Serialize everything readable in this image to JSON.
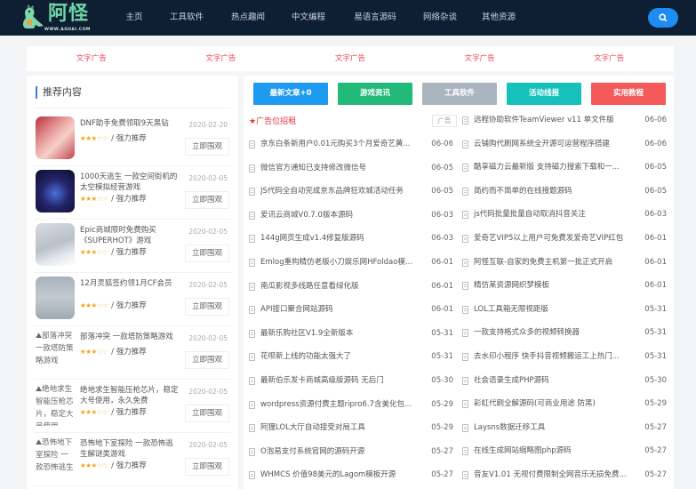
{
  "header": {
    "logo_text": "阿怪",
    "logo_url": "WWW.AGUAI.COM",
    "nav": [
      "主页",
      "工具软件",
      "热点趣闻",
      "中文编程",
      "易语言源码",
      "网络杂谈",
      "其他资源"
    ],
    "search_icon": "search-icon"
  },
  "adbar": {
    "items": [
      "文字广告",
      "文字广告",
      "文字广告",
      "文字广告",
      "文字广告"
    ],
    "color": "#e8495a"
  },
  "sidebar": {
    "title": "推荐内容",
    "meta_label": "/ 强力推荐",
    "button_label": "立即围观",
    "items": [
      {
        "title": "DNF助手免费领取9天黑钻",
        "date": "2020-02-20",
        "rating": 3,
        "thumb": "image"
      },
      {
        "title": "1000天逃生 一款空间街机的太空模拟经营游戏",
        "date": "2020-02-05",
        "rating": 3,
        "thumb": "image"
      },
      {
        "title": "Epic商城限时免费购买《SUPERHOT》游戏",
        "date": "2020-02-05",
        "rating": 3,
        "thumb": "image"
      },
      {
        "title": "12月灵狐签约领1月CF会员",
        "date": "2020-02-05",
        "rating": 3,
        "thumb": "image"
      },
      {
        "title": "部落冲突 一款塔防策略游戏",
        "date": "2020-02-05",
        "rating": 3,
        "thumb": "broken",
        "alt": "部落冲突 一款塔防策略游戏"
      },
      {
        "title": "绝地求生智能压枪芯片，稳定大号使用，永久免费",
        "date": "2020-02-05",
        "rating": 3,
        "thumb": "broken",
        "alt": "绝地求生智能压枪芯片，稳定大号使用"
      },
      {
        "title": "恐怖地下室探险 一款恐怖逃生解谜类游戏",
        "date": "2020-02-05",
        "rating": 3,
        "thumb": "broken",
        "alt": "恐怖地下室探险 一款恐怖逃生"
      }
    ]
  },
  "main": {
    "categories": [
      {
        "label": "最新文章+0",
        "color": "#1e9bf0"
      },
      {
        "label": "游戏资讯",
        "color": "#22b979"
      },
      {
        "label": "工具软件",
        "color": "#aab5bf"
      },
      {
        "label": "活动线报",
        "color": "#17c1bb"
      },
      {
        "label": "实用教程",
        "color": "#f45a5a"
      }
    ],
    "ad_recruit": "★广告位招租",
    "ad_tag": "广告",
    "left_articles": [
      {
        "title": "京东白条新用户0.01元购买3个月爱奇艺黄...",
        "date": "06-06"
      },
      {
        "title": "微信官方通知已支持修改微信号",
        "date": "06-05"
      },
      {
        "title": "JS代码全自动完成京东品牌狂欢城活动任务",
        "date": "06-05"
      },
      {
        "title": "爱讯云商城V0.7.0版本源码",
        "date": "06-03"
      },
      {
        "title": "144g网页生成v1.4修复版源码",
        "date": "06-03"
      },
      {
        "title": "Emlog重构精仿老版小刀娱乐网HFoldao模...",
        "date": "06-01"
      },
      {
        "title": "南瓜影视多线路任意看绿化版",
        "date": "06-01"
      },
      {
        "title": "API接口聚合网站源码",
        "date": "06-01"
      },
      {
        "title": "最新乐购社区V1.9全新版本",
        "date": "05-31"
      },
      {
        "title": "花呗新上线的功能太强大了",
        "date": "05-31"
      },
      {
        "title": "最新伯乐发卡商城高级版源码 无后门",
        "date": "05-30"
      },
      {
        "title": "wordpress资源付费主题ripro6.7含美化包...",
        "date": "05-29"
      },
      {
        "title": "阿狸LOL大厅自动接受对局工具",
        "date": "05-29"
      },
      {
        "title": "O泡易支付系统官网的源码开源",
        "date": "05-27"
      },
      {
        "title": "WHMCS 价值98美元的Lagom模板开源",
        "date": "05-27"
      }
    ],
    "right_articles": [
      {
        "title": "远程协助软件TeamViewer v11 单文件版",
        "date": "06-06"
      },
      {
        "title": "云铺购代刷网系统全开源可运营程序搭建",
        "date": "06-06"
      },
      {
        "title": "酷享磁力云最新版 支持磁力搜索下载和一...",
        "date": "06-05"
      },
      {
        "title": "简约而不简单的在线搜题源码",
        "date": "06-05"
      },
      {
        "title": "js代码批量批量自动取消抖音关注",
        "date": "06-03"
      },
      {
        "title": "爱奇艺VIP5以上用户可免费发爱奇艺VIP红包",
        "date": "06-01"
      },
      {
        "title": "阿怪互联-自家的免费主机第一批正式开启",
        "date": "06-01"
      },
      {
        "title": "精仿某资源网织梦模板",
        "date": "06-01"
      },
      {
        "title": "LOL工具箱无限视距版",
        "date": "05-31"
      },
      {
        "title": "一款支持格式众多的视频转换器",
        "date": "05-31"
      },
      {
        "title": "去水印小程序 快手抖音视频搬运工上热门...",
        "date": "05-31"
      },
      {
        "title": "社会语录生成PHP源码",
        "date": "05-30"
      },
      {
        "title": "彩虹代刷全解源码(可商业用途 防黑)",
        "date": "05-29"
      },
      {
        "title": "Laysns数据迁移工具",
        "date": "05-27"
      },
      {
        "title": "在线生成网站缩略图php源码",
        "date": "05-27"
      },
      {
        "title": "音友V1.01 无视付费限制全网音乐无损免费...",
        "date": "05-27"
      }
    ]
  }
}
